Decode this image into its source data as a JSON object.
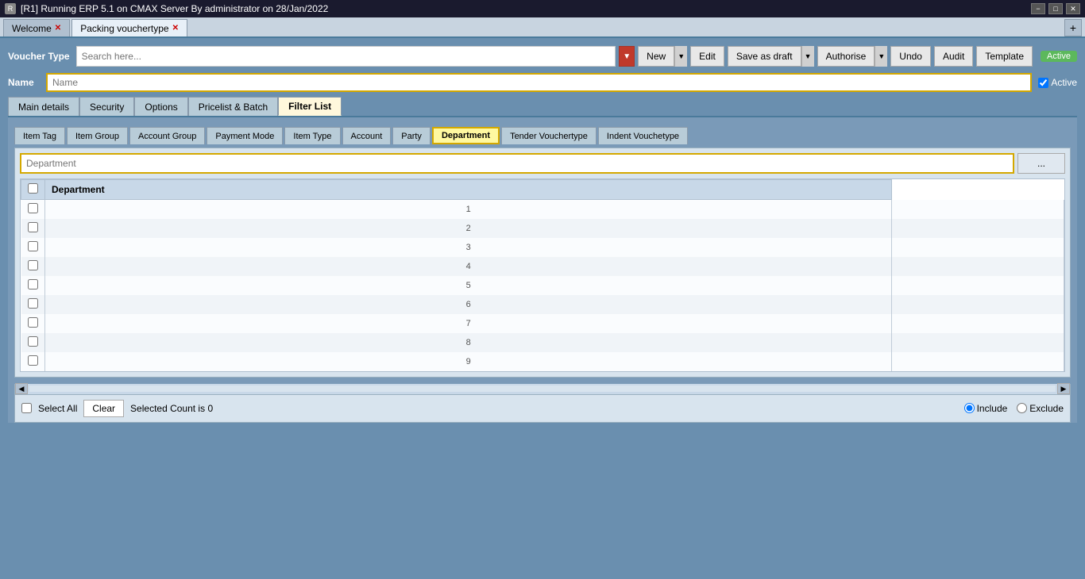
{
  "titlebar": {
    "icon": "R",
    "title": "[R1] Running ERP 5.1 on CMAX Server By administrator on 28/Jan/2022",
    "min_btn": "−",
    "max_btn": "□",
    "close_btn": "✕"
  },
  "tabs": [
    {
      "id": "welcome",
      "label": "Welcome",
      "closable": true,
      "active": false
    },
    {
      "id": "packing",
      "label": "Packing vouchertype",
      "closable": true,
      "active": true
    }
  ],
  "tab_add": "+",
  "toolbar": {
    "voucher_type_label": "Voucher Type",
    "search_placeholder": "Search here...",
    "new_btn": "New",
    "edit_btn": "Edit",
    "save_as_draft_btn": "Save as draft",
    "authorise_btn": "Authorise",
    "undo_btn": "Undo",
    "audit_btn": "Audit",
    "template_btn": "Template",
    "active_label": "Active"
  },
  "name_row": {
    "label": "Name",
    "placeholder": "Name",
    "active_label": "Active",
    "active_checked": true
  },
  "subtabs": [
    {
      "id": "main-details",
      "label": "Main details",
      "active": false
    },
    {
      "id": "security",
      "label": "Security",
      "active": false
    },
    {
      "id": "options",
      "label": "Options",
      "active": false
    },
    {
      "id": "pricelist-batch",
      "label": "Pricelist & Batch",
      "active": false
    },
    {
      "id": "filter-list",
      "label": "Filter List",
      "active": true
    }
  ],
  "filter_tabs": [
    {
      "id": "item-tag",
      "label": "Item Tag",
      "active": false
    },
    {
      "id": "item-group",
      "label": "Item Group",
      "active": false
    },
    {
      "id": "account-group",
      "label": "Account Group",
      "active": false
    },
    {
      "id": "payment-mode",
      "label": "Payment Mode",
      "active": false
    },
    {
      "id": "item-type",
      "label": "Item Type",
      "active": false
    },
    {
      "id": "account",
      "label": "Account",
      "active": false
    },
    {
      "id": "party",
      "label": "Party",
      "active": false
    },
    {
      "id": "department",
      "label": "Department",
      "active": true
    },
    {
      "id": "tender-vouchertype",
      "label": "Tender Vouchertype",
      "active": false
    },
    {
      "id": "indent-vouchetype",
      "label": "Indent Vouchetype",
      "active": false
    }
  ],
  "grid": {
    "search_placeholder": "Department",
    "dots_btn": "...",
    "column_header": "Department",
    "rows": [
      1,
      2,
      3,
      4,
      5,
      6,
      7,
      8,
      9
    ]
  },
  "bottom_bar": {
    "select_all_label": "Select All",
    "clear_btn": "Clear",
    "selected_count_label": "Selected Count is",
    "selected_count": "0",
    "include_label": "Include",
    "exclude_label": "Exclude"
  }
}
